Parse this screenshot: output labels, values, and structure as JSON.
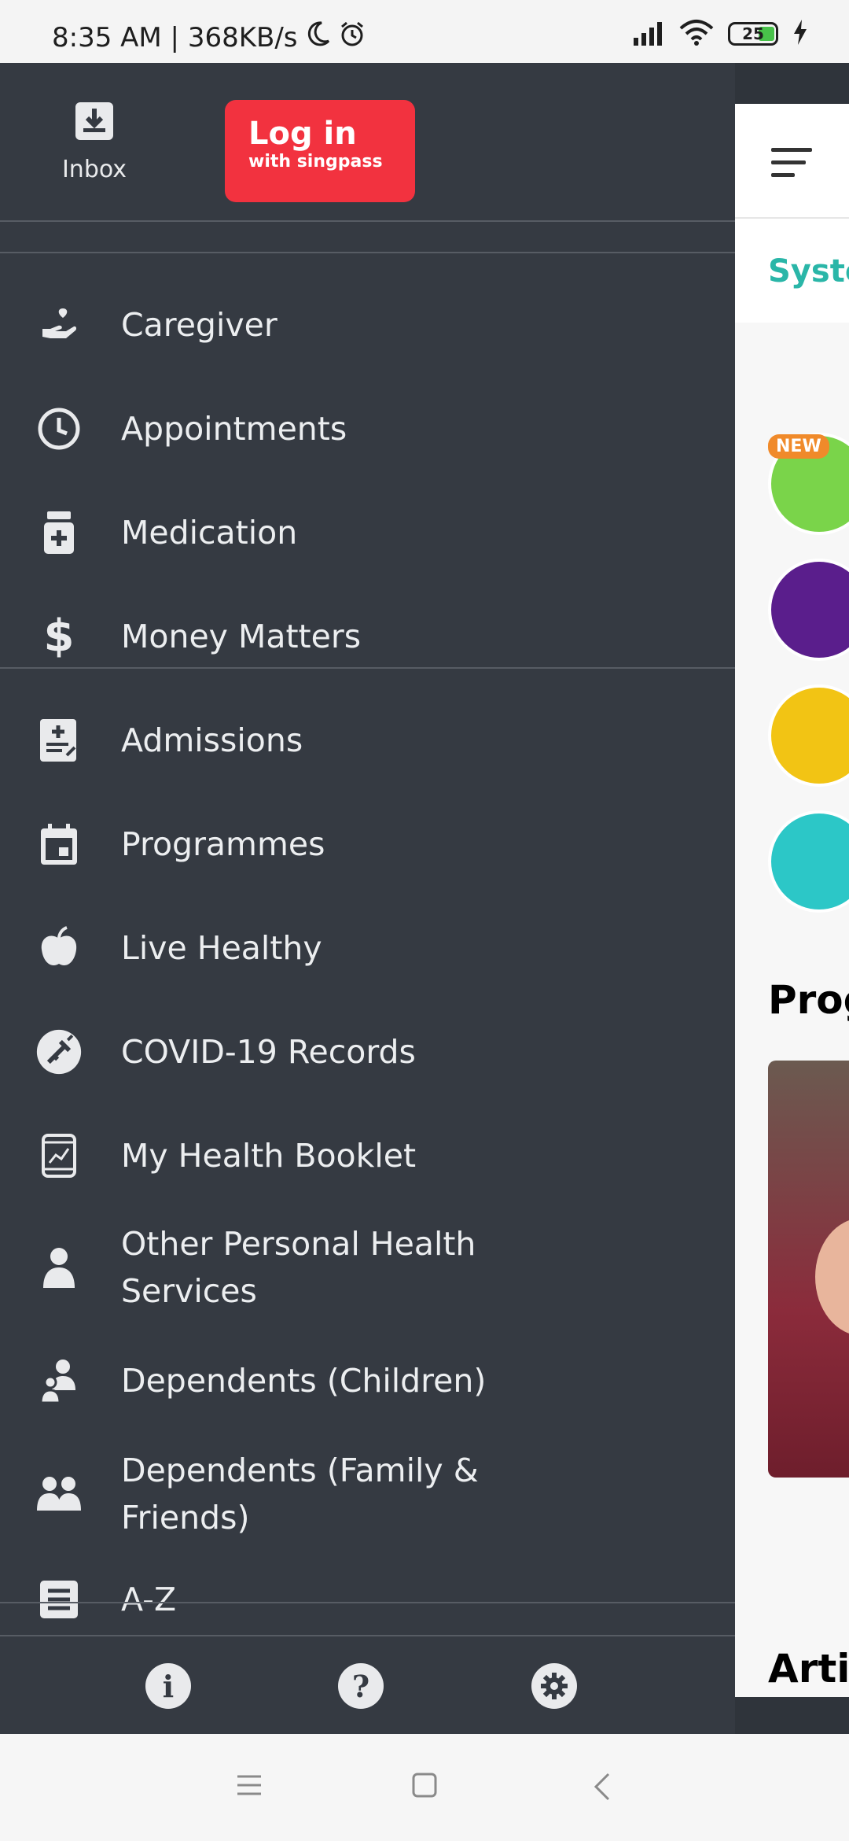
{
  "status_bar": {
    "time_speed": "8:35 AM | 368KB/s",
    "battery": "25"
  },
  "drawer": {
    "inbox_label": "Inbox",
    "login": {
      "line1": "Log in",
      "line2": "with singpass"
    },
    "items": [
      {
        "label": "Caregiver",
        "icon": "caregiver-hand-heart-icon"
      },
      {
        "label": "Appointments",
        "icon": "clock-icon"
      },
      {
        "label": "Medication",
        "icon": "medicine-bottle-icon"
      },
      {
        "label": "Money Matters",
        "icon": "dollar-icon"
      },
      {
        "label": "Admissions",
        "icon": "admissions-clipboard-icon"
      },
      {
        "label": "Programmes",
        "icon": "calendar-icon"
      },
      {
        "label": "Live Healthy",
        "icon": "apple-icon"
      },
      {
        "label": "COVID-19 Records",
        "icon": "covid-vaccine-icon"
      },
      {
        "label": "My Health Booklet",
        "icon": "health-booklet-icon"
      },
      {
        "label": "Other Personal Health Services",
        "icon": "person-icon"
      },
      {
        "label": "Dependents (Children)",
        "icon": "parent-child-icon"
      },
      {
        "label": "Dependents (Family & Friends)",
        "icon": "group-icon"
      },
      {
        "label": "A-Z",
        "icon": "list-icon"
      }
    ],
    "footer": [
      "info-icon",
      "help-icon",
      "settings-icon"
    ]
  },
  "content": {
    "section_text": "Syste",
    "new_badge": "NEW",
    "programmes_title": "Prog",
    "articles_title": "Arti"
  },
  "colors": {
    "drawer_bg": "#353a42",
    "login_red": "#f2323f",
    "teal": "#2ab6a8"
  }
}
